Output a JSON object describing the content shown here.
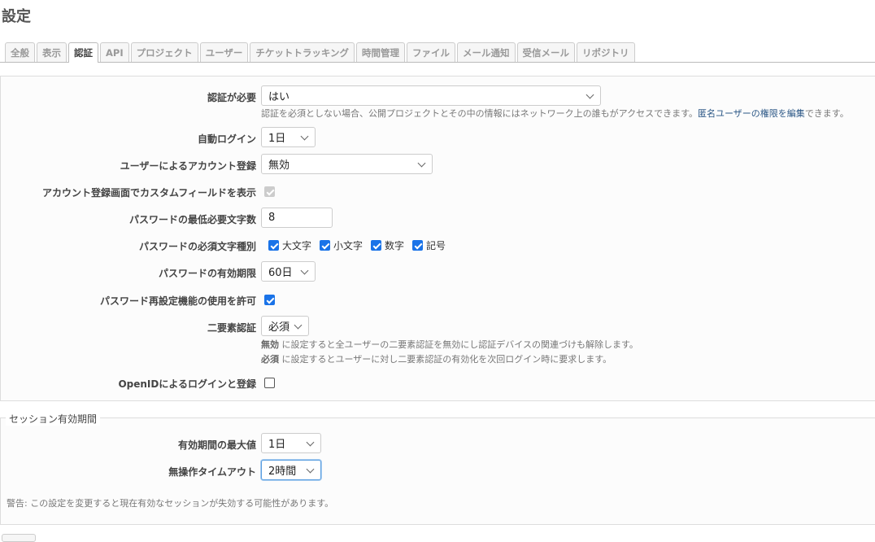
{
  "page_title": "設定",
  "tabs": [
    "全般",
    "表示",
    "認証",
    "API",
    "プロジェクト",
    "ユーザー",
    "チケットトラッキング",
    "時間管理",
    "ファイル",
    "メール通知",
    "受信メール",
    "リポジトリ"
  ],
  "active_tab": "認証",
  "auth": {
    "login_required": {
      "label": "認証が必要",
      "value": "はい",
      "hint_before": "認証を必須としない場合、公開プロジェクトとその中の情報にはネットワーク上の誰もがアクセスできます。",
      "hint_link": "匿名ユーザーの権限を編集",
      "hint_after": "できます。"
    },
    "autologin": {
      "label": "自動ログイン",
      "value": "1日"
    },
    "self_registration": {
      "label": "ユーザーによるアカウント登録",
      "value": "無効"
    },
    "custom_fields": {
      "label": "アカウント登録画面でカスタムフィールドを表示",
      "checked": true,
      "disabled": true
    },
    "password_min_length": {
      "label": "パスワードの最低必要文字数",
      "value": "8"
    },
    "password_required_chars": {
      "label": "パスワードの必須文字種別",
      "options": [
        {
          "label": "大文字",
          "checked": true
        },
        {
          "label": "小文字",
          "checked": true
        },
        {
          "label": "数字",
          "checked": true
        },
        {
          "label": "記号",
          "checked": true
        }
      ]
    },
    "password_max_age": {
      "label": "パスワードの有効期限",
      "value": "60日"
    },
    "lost_password": {
      "label": "パスワード再設定機能の使用を許可",
      "checked": true
    },
    "twofa": {
      "label": "二要素認証",
      "value": "必須",
      "hint1_key": "無効",
      "hint1_text": " に設定すると全ユーザーの二要素認証を無効にし認証デバイスの関連づけも解除します。",
      "hint2_key": "必須",
      "hint2_text": " に設定するとユーザーに対し二要素認証の有効化を次回ログイン時に要求します。"
    },
    "openid": {
      "label": "OpenIDによるログインと登録",
      "checked": false
    }
  },
  "session": {
    "legend": "セッション有効期間",
    "lifetime": {
      "label": "有効期間の最大値",
      "value": "1日"
    },
    "timeout": {
      "label": "無操作タイムアウト",
      "value": "2時間"
    },
    "warning": "警告: この設定を変更すると現在有効なセッションが失効する可能性があります。"
  },
  "colors": {
    "link": "#2a5685",
    "checkbox": "#1a73e8",
    "focus": "#5a9ee0"
  }
}
